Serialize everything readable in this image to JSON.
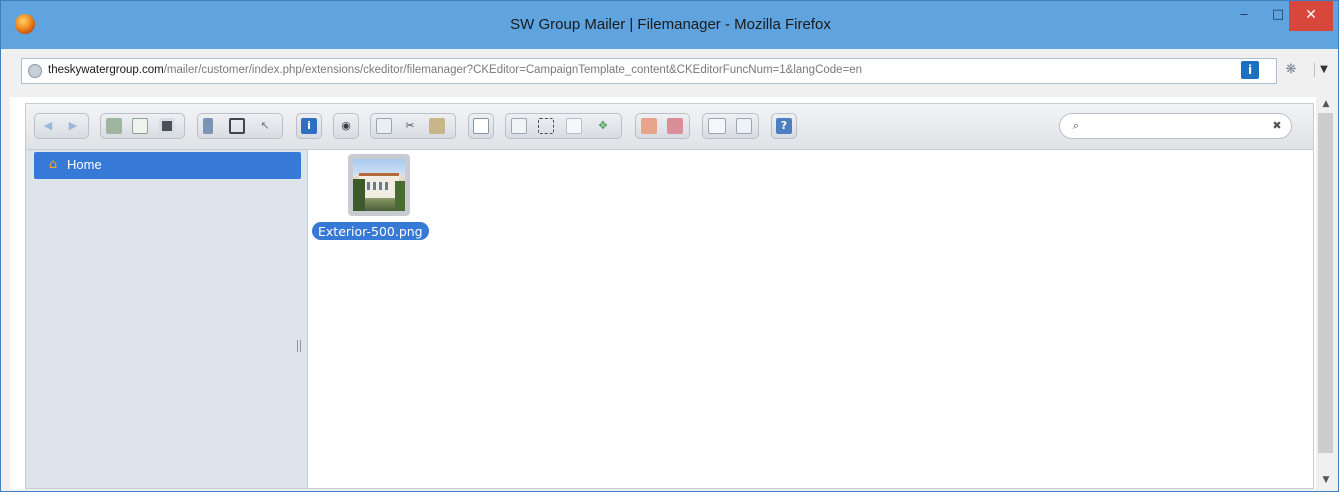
{
  "window": {
    "title": "SW Group Mailer | Filemanager - Mozilla Firefox",
    "minimize_glyph": "‒",
    "maximize_glyph": "□",
    "close_glyph": "✕"
  },
  "address_bar": {
    "host": "theskywatergroup.com",
    "path": "/mailer/customer/index.php/extensions/ckeditor/filemanager?CKEditor=CampaignTemplate_content&CKEditorFuncNum=1&langCode=en"
  },
  "toolbar": {
    "buttons": [
      "back",
      "forward",
      "mkdir",
      "upload",
      "save",
      "open",
      "save-as",
      "select",
      "info",
      "preview",
      "copy",
      "cut",
      "paste",
      "rename",
      "duplicate",
      "edit",
      "resize",
      "extract",
      "archive",
      "sort",
      "view-icons",
      "view-list",
      "help"
    ],
    "search": {
      "value": "",
      "placeholder": ""
    }
  },
  "sidebar": {
    "tree": [
      {
        "label": "Home",
        "icon": "home-icon",
        "selected": true
      }
    ]
  },
  "files": [
    {
      "name": "Exterior-500.png",
      "selected": true
    }
  ],
  "colors": {
    "titlebar": "#5fa3df",
    "selection": "#3779d6",
    "close_button": "#d9463b"
  }
}
